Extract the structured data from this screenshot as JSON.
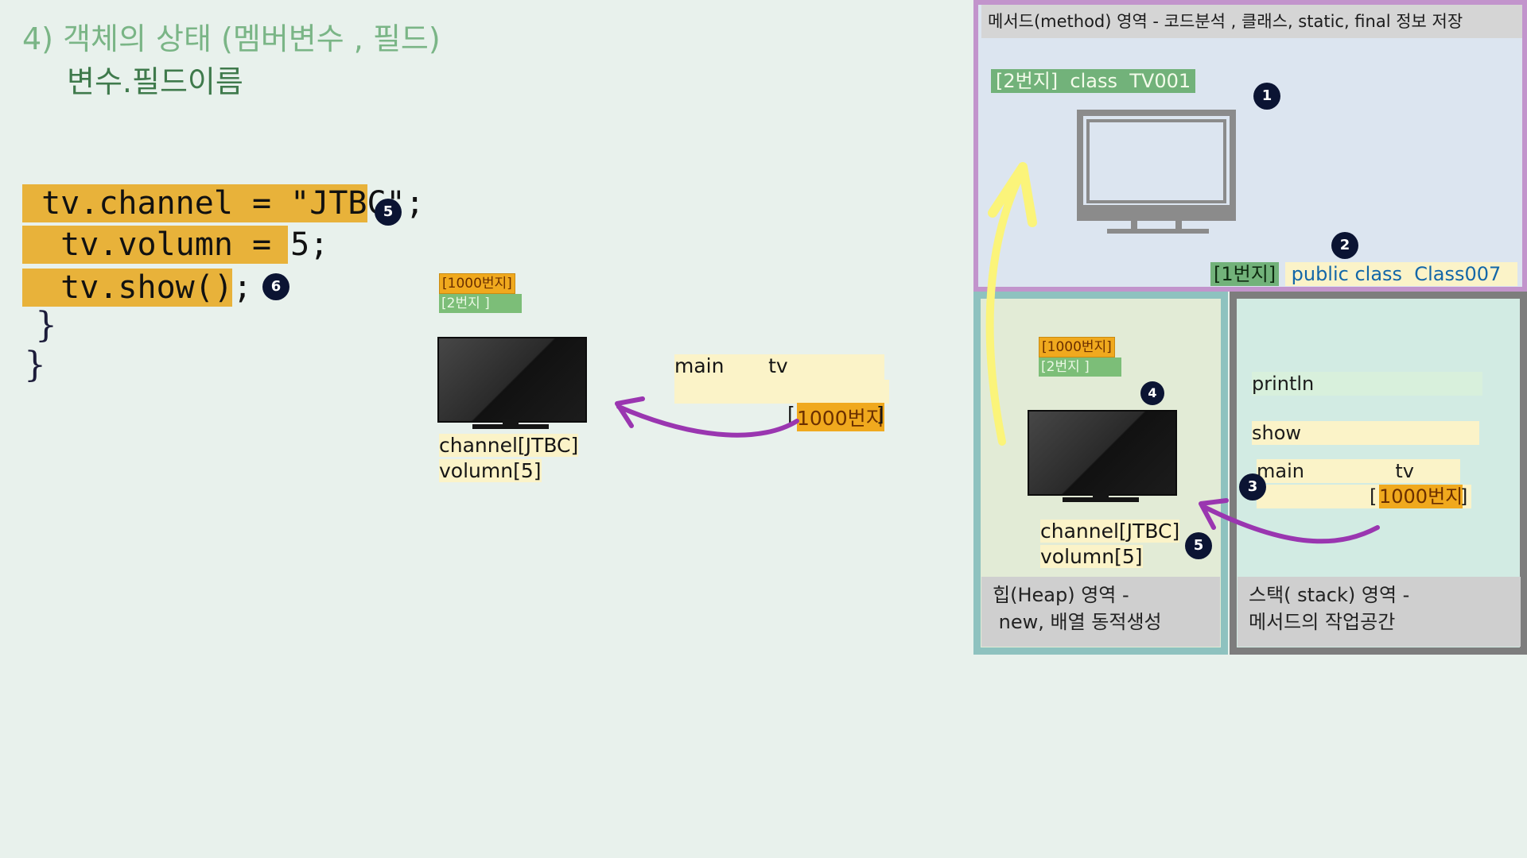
{
  "heading": {
    "line1": "4) 객체의 상태 (멤버변수 , 필드)",
    "line2": "변수.필드이름"
  },
  "code": {
    "line1": " tv.channel = \"JTBC\";",
    "line2": "  tv.volumn = 5;",
    "line3": "  tv.show();",
    "brace1": "}",
    "brace2": "}",
    "badge_line1": "5",
    "badge_line3": "6"
  },
  "middle": {
    "tag_orange": "[1000번지]",
    "tag_green": "[2번지    ]",
    "field1": "channel[JTBC]",
    "field2": "volumn[5]",
    "stack_row1": "main       tv",
    "stack_row2_prefix": "[",
    "stack_row2_addr": "1000번지",
    "stack_row2_suffix": "]"
  },
  "method_area": {
    "header": "메서드(method) 영역  - 코드분석 , 클래스, static, final 정보 저장",
    "class_tv_tag": "[2번지]  class  TV001",
    "badge1": "1",
    "badge2": "2",
    "class007_addr": "[1번지]",
    "class007_label": " public class  Class007"
  },
  "heap_area": {
    "tag_orange": "[1000번지]",
    "tag_green": "[2번지    ]",
    "badge4": "4",
    "badge5": "5",
    "field1": "channel[JTBC]",
    "field2": "volumn[5]",
    "footer": "힙(Heap) 영역 -\n new, 배열 동적생성"
  },
  "stack_area": {
    "frame_println": "println",
    "frame_show": "show",
    "frame_main": "main               tv",
    "main_addr_prefix": "[",
    "main_addr": "1000번지",
    "main_addr_suffix": "]",
    "badge3": "3",
    "footer": "스택( stack) 영역 -\n메서드의 작업공간"
  },
  "colors": {
    "background": "#e8f1ec",
    "code_highlight": "#e8b23a",
    "arrow_purple": "#9a36b0",
    "arrow_yellow": "#fbf47a",
    "method_border": "#c294cc",
    "heap_border": "#8ec2bf",
    "stack_border": "#7d7d7d"
  },
  "icons": [
    "tv-outline-icon",
    "tv-icon",
    "arrow-icon"
  ]
}
